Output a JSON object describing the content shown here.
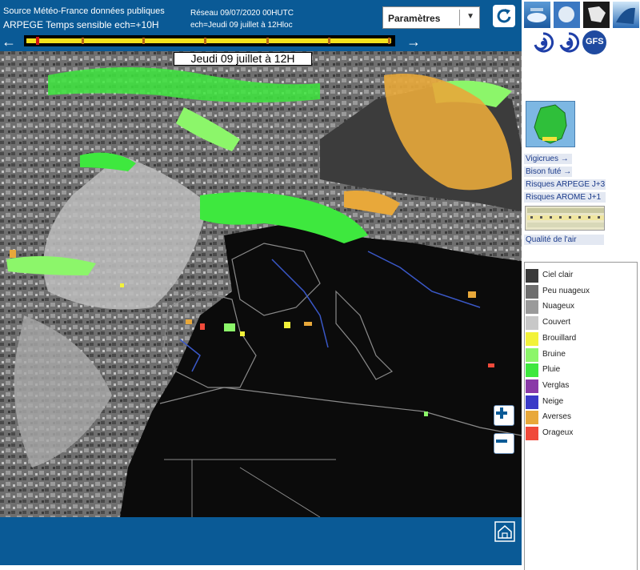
{
  "header": {
    "source": "Source Météo-France données publiques",
    "model": "ARPEGE Temps sensible ech=+10H",
    "run": "Réseau 09/07/2020 00HUTC",
    "echeance": "ech=Jeudi 09 juillet à 12Hloc",
    "params_label": "Paramètres"
  },
  "map": {
    "date_label": "Jeudi 09 juillet à 12H"
  },
  "links": {
    "vigicrues": "Vigicrues →",
    "bison": "Bison futé →",
    "arpege": "Risques ARPEGE J+3",
    "arome": "Risques AROME J+1",
    "air": "Qualité de l'air"
  },
  "model_labels": {
    "gfs": "GFS"
  },
  "legend": [
    {
      "label": "Ciel clair",
      "color": "#3a3a3a"
    },
    {
      "label": "Peu nuageux",
      "color": "#6e6e6e"
    },
    {
      "label": "Nuageux",
      "color": "#9a9a9a"
    },
    {
      "label": "Couvert",
      "color": "#c8c8c8"
    },
    {
      "label": "Brouillard",
      "color": "#f2f23a"
    },
    {
      "label": "Bruine",
      "color": "#8cf66a"
    },
    {
      "label": "Pluie",
      "color": "#3ee83e"
    },
    {
      "label": "Verglas",
      "color": "#8a3aa8"
    },
    {
      "label": "Neige",
      "color": "#3a3ac8"
    },
    {
      "label": "Averses",
      "color": "#e8a83a"
    },
    {
      "label": "Orageux",
      "color": "#f04a3a"
    }
  ],
  "icons": {
    "refresh": "refresh-icon",
    "prev": "arrow-left-icon",
    "next": "arrow-right-icon",
    "zoom_in": "plus-icon",
    "zoom_out": "minus-icon",
    "home": "home-icon"
  }
}
